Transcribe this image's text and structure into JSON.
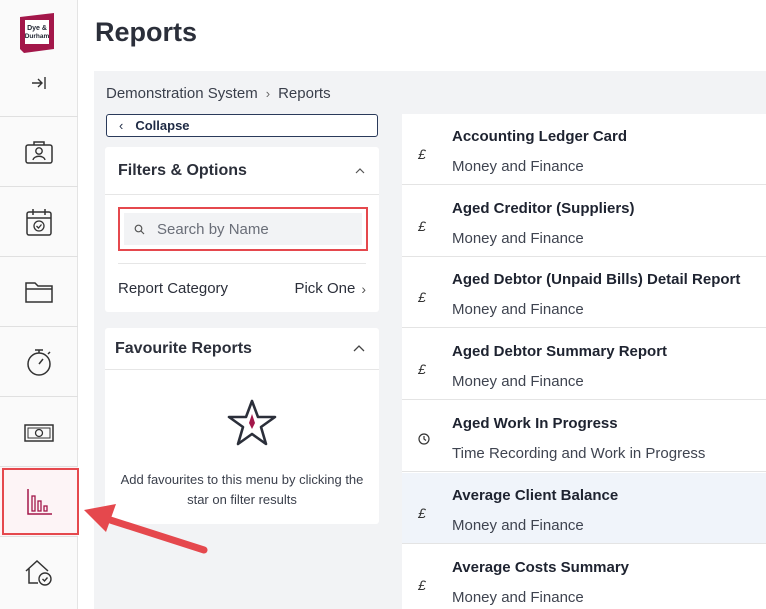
{
  "app": {
    "logo_text": [
      "Dye &",
      "Durham"
    ],
    "brand_color": "#a3174a"
  },
  "rail": {
    "expand_icon": "expand-right-icon",
    "items": [
      {
        "icon": "briefcase-person-icon"
      },
      {
        "icon": "calendar-check-icon"
      },
      {
        "icon": "folder-icon"
      },
      {
        "icon": "stopwatch-icon"
      },
      {
        "icon": "banknote-icon"
      },
      {
        "icon": "bar-chart-icon",
        "active": true
      },
      {
        "icon": "house-check-icon"
      }
    ]
  },
  "page": {
    "title": "Reports"
  },
  "breadcrumb": {
    "root": "Demonstration System",
    "current": "Reports"
  },
  "collapse": {
    "label": "Collapse"
  },
  "filters": {
    "title": "Filters & Options",
    "search_placeholder": "Search by Name",
    "category_label": "Report Category",
    "category_value": "Pick One"
  },
  "favourites": {
    "title": "Favourite Reports",
    "empty_text": "Add favourites to this menu by clicking the star on filter results"
  },
  "reports": [
    {
      "icon": "£",
      "title": "Accounting Ledger Card",
      "category": "Money and Finance"
    },
    {
      "icon": "£",
      "title": "Aged Creditor (Suppliers)",
      "category": "Money and Finance"
    },
    {
      "icon": "£",
      "title": "Aged Debtor (Unpaid Bills) Detail Report",
      "category": "Money and Finance"
    },
    {
      "icon": "£",
      "title": "Aged Debtor Summary Report",
      "category": "Money and Finance"
    },
    {
      "icon": "clock-icon",
      "title": "Aged Work In Progress",
      "category": "Time Recording and Work in Progress"
    },
    {
      "icon": "£",
      "title": "Average Client Balance",
      "category": "Money and Finance"
    },
    {
      "icon": "£",
      "title": "Average Costs Summary",
      "category": "Money and Finance"
    }
  ],
  "colors": {
    "highlight": "#e5484d",
    "accent": "#a3174a",
    "content_bg": "#f2f3f5"
  }
}
